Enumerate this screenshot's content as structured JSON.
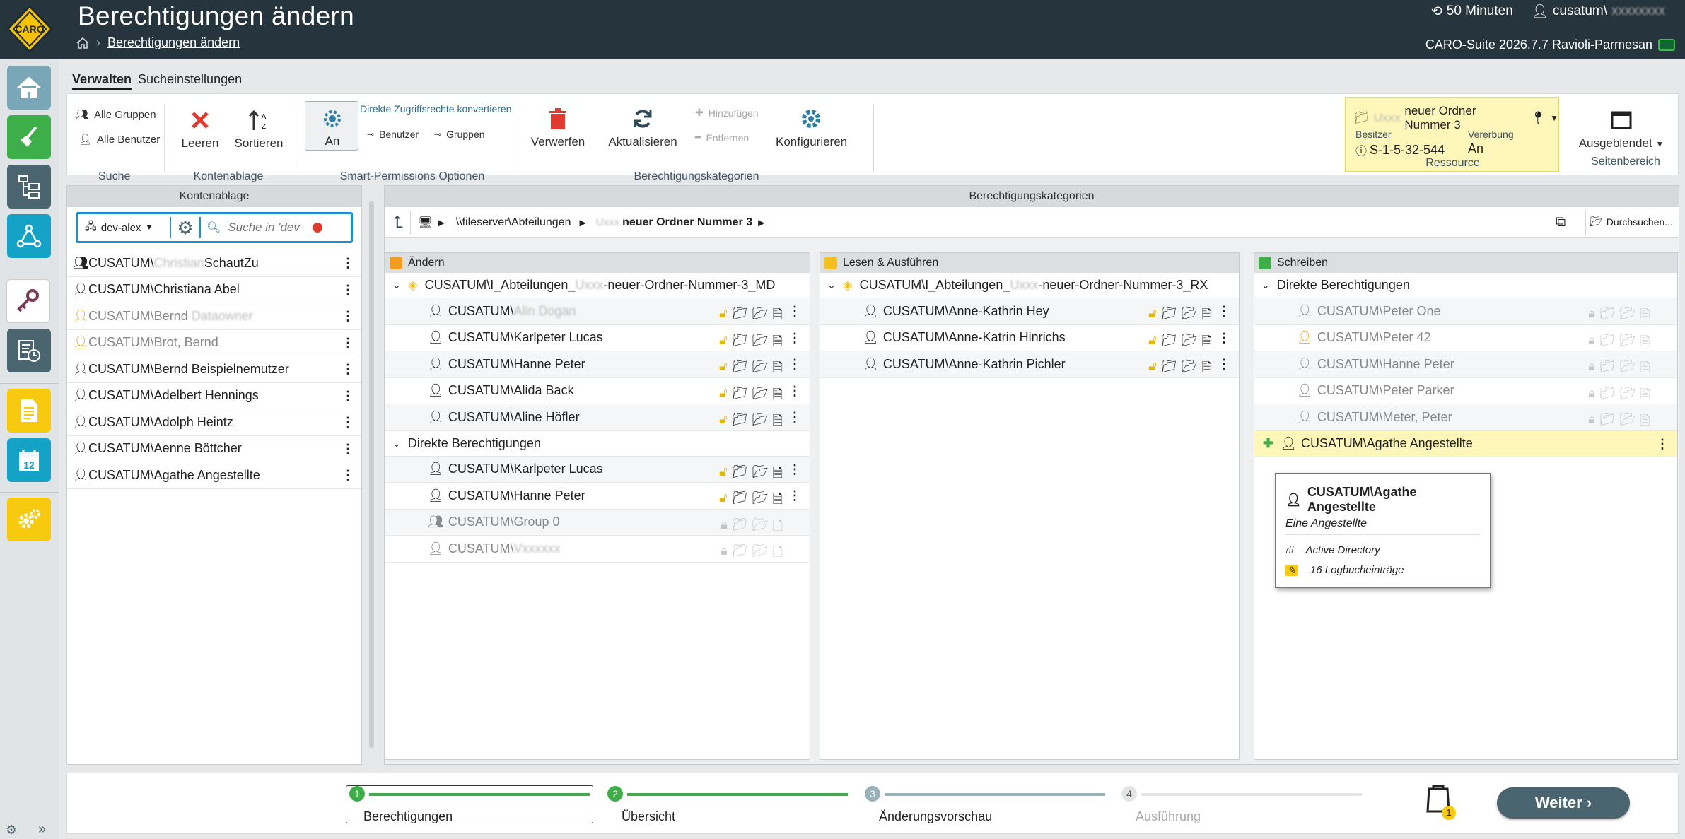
{
  "header": {
    "title": "Berechtigungen ändern",
    "breadcrumb": "Berechtigungen ändern",
    "session_time": "50 Minuten",
    "user": "cusatum\\",
    "version": "CARO-Suite 2026.7.7 Ravioli-Parmesan",
    "logo_text": "CARO"
  },
  "ribbon": {
    "tabs": [
      "Verwalten",
      "Sucheinstellungen"
    ],
    "alle_gruppen": "Alle Gruppen",
    "alle_benutzer": "Alle Benutzer",
    "suche": "Suche",
    "leeren": "Leeren",
    "sortieren": "Sortieren",
    "kontenablage": "Kontenablage",
    "an": "An",
    "direkte_konvertieren": "Direkte Zugriffsrechte konvertieren",
    "benutzer": "Benutzer",
    "gruppen": "Gruppen",
    "smart_options": "Smart-Permissions Optionen",
    "verwerfen": "Verwerfen",
    "aktualisieren": "Aktualisieren",
    "hinzufuegen": "Hinzufügen",
    "entfernen": "Entfernen",
    "konfigurieren": "Konfigurieren",
    "berechtigungskategorien": "Berechtigungskategorien",
    "resource_name": "neuer Ordner Nummer 3",
    "besitzer_label": "Besitzer",
    "besitzer_value": "S-1-5-32-544",
    "vererbung_label": "Vererbung",
    "vererbung_value": "An",
    "ressource": "Ressource",
    "ausgeblendet": "Ausgeblendet",
    "seitenbereich": "Seitenbereich"
  },
  "kontenablage": {
    "title": "Kontenablage",
    "domain_select": "dev-alex",
    "search_placeholder": "Suche in 'dev-",
    "items": [
      {
        "prefix": "CUSATUM\\",
        "name": "Christian",
        "suffix": "SchautZu",
        "grey": false
      },
      {
        "prefix": "CUSATUM\\",
        "name": "Christiana Abel",
        "suffix": "",
        "grey": false
      },
      {
        "prefix": "CUSATUM\\",
        "name": "Bernd",
        "suffix": "Dataowner",
        "grey": true
      },
      {
        "prefix": "CUSATUM\\",
        "name": "Brot, Bernd",
        "suffix": "",
        "grey": true
      },
      {
        "prefix": "CUSATUM\\",
        "name": "Bernd Beispielnemutzer",
        "suffix": "",
        "grey": false
      },
      {
        "prefix": "CUSATUM\\",
        "name": "Adelbert Hennings",
        "suffix": "",
        "grey": false
      },
      {
        "prefix": "CUSATUM\\",
        "name": "Adolph Heintz",
        "suffix": "",
        "grey": false
      },
      {
        "prefix": "CUSATUM\\",
        "name": "Aenne Böttcher",
        "suffix": "",
        "grey": false
      },
      {
        "prefix": "CUSATUM\\",
        "name": "Agathe Angestellte",
        "suffix": "",
        "grey": false
      }
    ]
  },
  "kategorien": {
    "title": "Berechtigungskategorien",
    "path_server": "\\\\fileserver\\Abteilungen",
    "path_folder": "neuer Ordner Nummer 3",
    "browse": "Durchsuchen...",
    "columns": {
      "aendern": {
        "label": "Ändern",
        "color": "#f39c1f",
        "group_prefix": "CUSATUM\\I_Abteilungen_",
        "group_suffix": "-neuer-Ordner-Nummer-3_MD",
        "group_members": [
          "CUSATUM\\",
          "CUSATUM\\Karlpeter Lucas",
          "CUSATUM\\Hanne Peter",
          "CUSATUM\\Alida Back",
          "CUSATUM\\Aline Höfler"
        ],
        "blur_member": "Alin Dogan",
        "direkte_label": "Direkte Berechtigungen",
        "direkte": [
          "CUSATUM\\Karlpeter Lucas",
          "CUSATUM\\Hanne Peter",
          "CUSATUM\\Group 0",
          "CUSATUM\\"
        ]
      },
      "lesen": {
        "label": "Lesen & Ausführen",
        "color": "#f3c01f",
        "group_prefix": "CUSATUM\\I_Abteilungen_",
        "group_suffix": "-neuer-Ordner-Nummer-3_RX",
        "group_members": [
          "CUSATUM\\Anne-Kathrin Hey",
          "CUSATUM\\Anne-Katrin Hinrichs",
          "CUSATUM\\Anne-Kathrin Pichler"
        ]
      },
      "schreiben": {
        "label": "Schreiben",
        "color": "#3fae49",
        "direkte_label": "Direkte Berechtigungen",
        "direkte": [
          "CUSATUM\\Peter One",
          "CUSATUM\\Peter 42",
          "CUSATUM\\Hanne Peter",
          "CUSATUM\\Peter Parker",
          "CUSATUM\\Meter, Peter"
        ],
        "added": "CUSATUM\\Agathe Angestellte"
      }
    }
  },
  "tooltip": {
    "name": "CUSATUM\\Agathe Angestellte",
    "description": "Eine Angestellte",
    "source": "Active Directory",
    "log": "16 Logbucheinträge"
  },
  "wizard": {
    "steps": [
      {
        "num": "1",
        "label": "Berechtigungen"
      },
      {
        "num": "2",
        "label": "Übersicht"
      },
      {
        "num": "3",
        "label": "Änderungsvorschau"
      },
      {
        "num": "4",
        "label": "Ausführung"
      }
    ],
    "cart_count": "1",
    "weiter": "Weiter"
  }
}
